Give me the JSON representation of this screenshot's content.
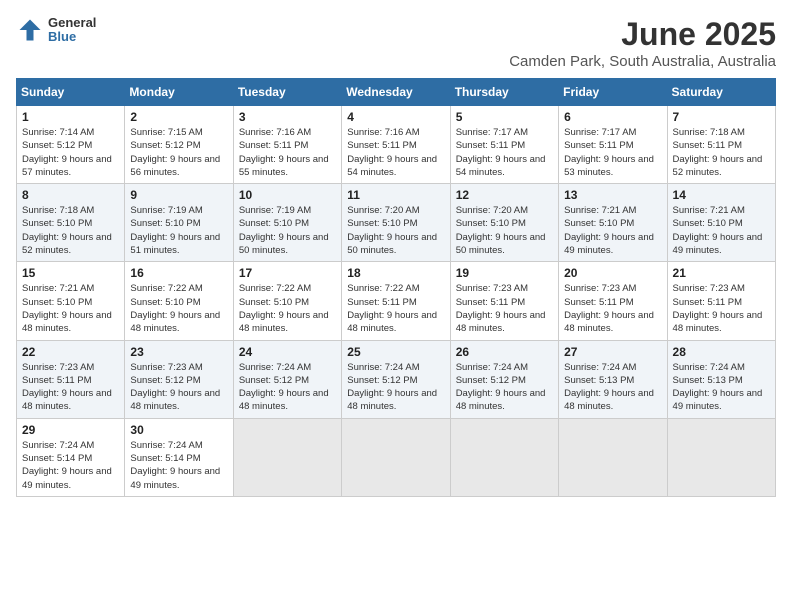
{
  "header": {
    "logo_general": "General",
    "logo_blue": "Blue",
    "main_title": "June 2025",
    "sub_title": "Camden Park, South Australia, Australia"
  },
  "calendar": {
    "days_of_week": [
      "Sunday",
      "Monday",
      "Tuesday",
      "Wednesday",
      "Thursday",
      "Friday",
      "Saturday"
    ],
    "weeks": [
      [
        null,
        null,
        null,
        null,
        null,
        null,
        null
      ]
    ],
    "cells": [
      {
        "day": null,
        "sunrise": "",
        "sunset": "",
        "daylight": ""
      },
      {
        "day": null,
        "sunrise": "",
        "sunset": "",
        "daylight": ""
      },
      {
        "day": null,
        "sunrise": "",
        "sunset": "",
        "daylight": ""
      },
      {
        "day": null,
        "sunrise": "",
        "sunset": "",
        "daylight": ""
      },
      {
        "day": null,
        "sunrise": "",
        "sunset": "",
        "daylight": ""
      },
      {
        "day": null,
        "sunrise": "",
        "sunset": "",
        "daylight": ""
      },
      {
        "day": null,
        "sunrise": "",
        "sunset": "",
        "daylight": ""
      }
    ]
  },
  "days": {
    "row1": [
      {
        "num": "1",
        "sunrise": "Sunrise: 7:14 AM",
        "sunset": "Sunset: 5:12 PM",
        "daylight": "Daylight: 9 hours and 57 minutes."
      },
      {
        "num": "2",
        "sunrise": "Sunrise: 7:15 AM",
        "sunset": "Sunset: 5:12 PM",
        "daylight": "Daylight: 9 hours and 56 minutes."
      },
      {
        "num": "3",
        "sunrise": "Sunrise: 7:16 AM",
        "sunset": "Sunset: 5:11 PM",
        "daylight": "Daylight: 9 hours and 55 minutes."
      },
      {
        "num": "4",
        "sunrise": "Sunrise: 7:16 AM",
        "sunset": "Sunset: 5:11 PM",
        "daylight": "Daylight: 9 hours and 54 minutes."
      },
      {
        "num": "5",
        "sunrise": "Sunrise: 7:17 AM",
        "sunset": "Sunset: 5:11 PM",
        "daylight": "Daylight: 9 hours and 54 minutes."
      },
      {
        "num": "6",
        "sunrise": "Sunrise: 7:17 AM",
        "sunset": "Sunset: 5:11 PM",
        "daylight": "Daylight: 9 hours and 53 minutes."
      },
      {
        "num": "7",
        "sunrise": "Sunrise: 7:18 AM",
        "sunset": "Sunset: 5:11 PM",
        "daylight": "Daylight: 9 hours and 52 minutes."
      }
    ],
    "row2": [
      {
        "num": "8",
        "sunrise": "Sunrise: 7:18 AM",
        "sunset": "Sunset: 5:10 PM",
        "daylight": "Daylight: 9 hours and 52 minutes."
      },
      {
        "num": "9",
        "sunrise": "Sunrise: 7:19 AM",
        "sunset": "Sunset: 5:10 PM",
        "daylight": "Daylight: 9 hours and 51 minutes."
      },
      {
        "num": "10",
        "sunrise": "Sunrise: 7:19 AM",
        "sunset": "Sunset: 5:10 PM",
        "daylight": "Daylight: 9 hours and 50 minutes."
      },
      {
        "num": "11",
        "sunrise": "Sunrise: 7:20 AM",
        "sunset": "Sunset: 5:10 PM",
        "daylight": "Daylight: 9 hours and 50 minutes."
      },
      {
        "num": "12",
        "sunrise": "Sunrise: 7:20 AM",
        "sunset": "Sunset: 5:10 PM",
        "daylight": "Daylight: 9 hours and 50 minutes."
      },
      {
        "num": "13",
        "sunrise": "Sunrise: 7:21 AM",
        "sunset": "Sunset: 5:10 PM",
        "daylight": "Daylight: 9 hours and 49 minutes."
      },
      {
        "num": "14",
        "sunrise": "Sunrise: 7:21 AM",
        "sunset": "Sunset: 5:10 PM",
        "daylight": "Daylight: 9 hours and 49 minutes."
      }
    ],
    "row3": [
      {
        "num": "15",
        "sunrise": "Sunrise: 7:21 AM",
        "sunset": "Sunset: 5:10 PM",
        "daylight": "Daylight: 9 hours and 48 minutes."
      },
      {
        "num": "16",
        "sunrise": "Sunrise: 7:22 AM",
        "sunset": "Sunset: 5:10 PM",
        "daylight": "Daylight: 9 hours and 48 minutes."
      },
      {
        "num": "17",
        "sunrise": "Sunrise: 7:22 AM",
        "sunset": "Sunset: 5:10 PM",
        "daylight": "Daylight: 9 hours and 48 minutes."
      },
      {
        "num": "18",
        "sunrise": "Sunrise: 7:22 AM",
        "sunset": "Sunset: 5:11 PM",
        "daylight": "Daylight: 9 hours and 48 minutes."
      },
      {
        "num": "19",
        "sunrise": "Sunrise: 7:23 AM",
        "sunset": "Sunset: 5:11 PM",
        "daylight": "Daylight: 9 hours and 48 minutes."
      },
      {
        "num": "20",
        "sunrise": "Sunrise: 7:23 AM",
        "sunset": "Sunset: 5:11 PM",
        "daylight": "Daylight: 9 hours and 48 minutes."
      },
      {
        "num": "21",
        "sunrise": "Sunrise: 7:23 AM",
        "sunset": "Sunset: 5:11 PM",
        "daylight": "Daylight: 9 hours and 48 minutes."
      }
    ],
    "row4": [
      {
        "num": "22",
        "sunrise": "Sunrise: 7:23 AM",
        "sunset": "Sunset: 5:11 PM",
        "daylight": "Daylight: 9 hours and 48 minutes."
      },
      {
        "num": "23",
        "sunrise": "Sunrise: 7:23 AM",
        "sunset": "Sunset: 5:12 PM",
        "daylight": "Daylight: 9 hours and 48 minutes."
      },
      {
        "num": "24",
        "sunrise": "Sunrise: 7:24 AM",
        "sunset": "Sunset: 5:12 PM",
        "daylight": "Daylight: 9 hours and 48 minutes."
      },
      {
        "num": "25",
        "sunrise": "Sunrise: 7:24 AM",
        "sunset": "Sunset: 5:12 PM",
        "daylight": "Daylight: 9 hours and 48 minutes."
      },
      {
        "num": "26",
        "sunrise": "Sunrise: 7:24 AM",
        "sunset": "Sunset: 5:12 PM",
        "daylight": "Daylight: 9 hours and 48 minutes."
      },
      {
        "num": "27",
        "sunrise": "Sunrise: 7:24 AM",
        "sunset": "Sunset: 5:13 PM",
        "daylight": "Daylight: 9 hours and 48 minutes."
      },
      {
        "num": "28",
        "sunrise": "Sunrise: 7:24 AM",
        "sunset": "Sunset: 5:13 PM",
        "daylight": "Daylight: 9 hours and 49 minutes."
      }
    ],
    "row5": [
      {
        "num": "29",
        "sunrise": "Sunrise: 7:24 AM",
        "sunset": "Sunset: 5:14 PM",
        "daylight": "Daylight: 9 hours and 49 minutes."
      },
      {
        "num": "30",
        "sunrise": "Sunrise: 7:24 AM",
        "sunset": "Sunset: 5:14 PM",
        "daylight": "Daylight: 9 hours and 49 minutes."
      }
    ]
  }
}
